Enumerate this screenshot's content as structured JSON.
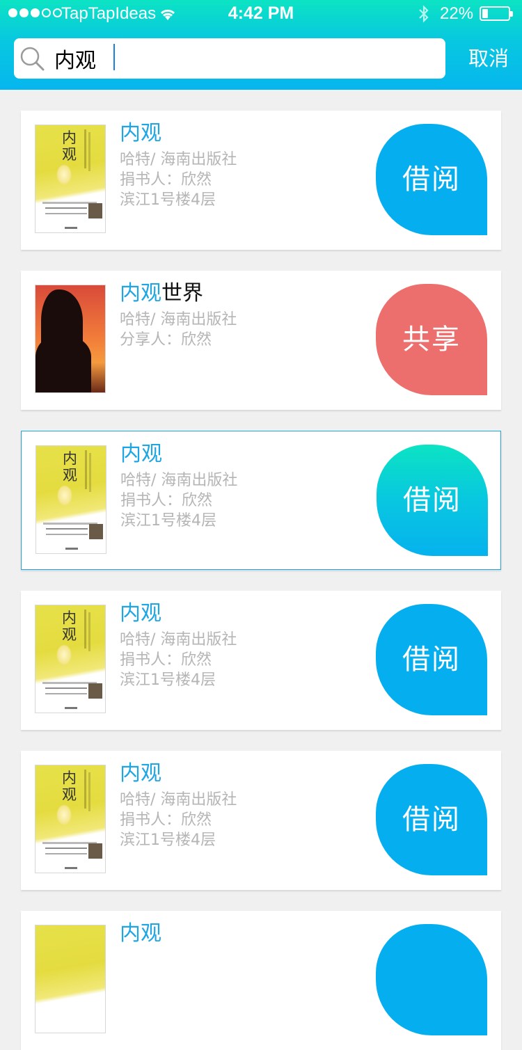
{
  "status_bar": {
    "carrier": "TapTapIdeas",
    "time": "4:42 PM",
    "battery": "22%",
    "battery_level": 0.22,
    "signal_bars": 3
  },
  "search": {
    "query": "内观",
    "cancel_label": "取消"
  },
  "results": [
    {
      "highlight": "内观",
      "title_rest": "",
      "author_publisher": "哈特/ 海南出版社",
      "person": "捐书人：欣然",
      "location": "滨江1号楼4层",
      "action": "借阅",
      "cover": "book"
    },
    {
      "highlight": "内观",
      "title_rest": "世界",
      "author_publisher": "哈特/ 海南出版社",
      "person": "分享人：欣然",
      "location": "",
      "action": "共享",
      "cover": "photo"
    },
    {
      "highlight": "内观",
      "title_rest": "",
      "author_publisher": "哈特/ 海南出版社",
      "person": "捐书人：欣然",
      "location": "滨江1号楼4层",
      "action": "借阅",
      "cover": "book"
    },
    {
      "highlight": "内观",
      "title_rest": "",
      "author_publisher": "哈特/ 海南出版社",
      "person": "捐书人：欣然",
      "location": "滨江1号楼4层",
      "action": "借阅",
      "cover": "book"
    },
    {
      "highlight": "内观",
      "title_rest": "",
      "author_publisher": "哈特/ 海南出版社",
      "person": "捐书人：欣然",
      "location": "滨江1号楼4层",
      "action": "借阅",
      "cover": "book"
    },
    {
      "highlight": "内观",
      "title_rest": "",
      "author_publisher": "",
      "person": "",
      "location": "",
      "action": "",
      "cover": "book"
    }
  ],
  "cover_text": "内观",
  "colors": {
    "accent_blue": "#05aeee",
    "share_red": "#ec6f6d",
    "header_gradient_top": "#0ce3c3",
    "header_gradient_bottom": "#06b6ee",
    "title_highlight": "#1ea5e3",
    "meta_gray": "#b5b5b5"
  }
}
